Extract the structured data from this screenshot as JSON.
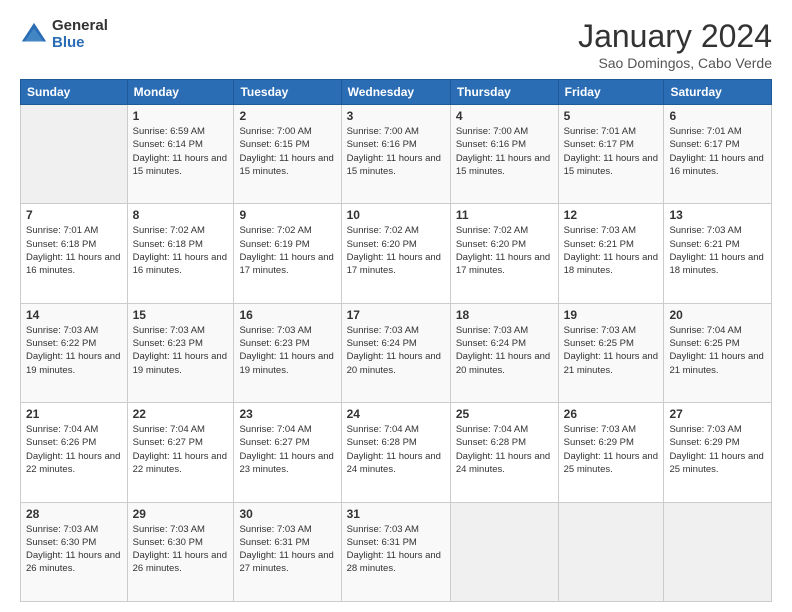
{
  "logo": {
    "general": "General",
    "blue": "Blue"
  },
  "title": "January 2024",
  "location": "Sao Domingos, Cabo Verde",
  "headers": [
    "Sunday",
    "Monday",
    "Tuesday",
    "Wednesday",
    "Thursday",
    "Friday",
    "Saturday"
  ],
  "weeks": [
    [
      {
        "day": "",
        "sunrise": "",
        "sunset": "",
        "daylight": ""
      },
      {
        "day": "1",
        "sunrise": "Sunrise: 6:59 AM",
        "sunset": "Sunset: 6:14 PM",
        "daylight": "Daylight: 11 hours and 15 minutes."
      },
      {
        "day": "2",
        "sunrise": "Sunrise: 7:00 AM",
        "sunset": "Sunset: 6:15 PM",
        "daylight": "Daylight: 11 hours and 15 minutes."
      },
      {
        "day": "3",
        "sunrise": "Sunrise: 7:00 AM",
        "sunset": "Sunset: 6:16 PM",
        "daylight": "Daylight: 11 hours and 15 minutes."
      },
      {
        "day": "4",
        "sunrise": "Sunrise: 7:00 AM",
        "sunset": "Sunset: 6:16 PM",
        "daylight": "Daylight: 11 hours and 15 minutes."
      },
      {
        "day": "5",
        "sunrise": "Sunrise: 7:01 AM",
        "sunset": "Sunset: 6:17 PM",
        "daylight": "Daylight: 11 hours and 15 minutes."
      },
      {
        "day": "6",
        "sunrise": "Sunrise: 7:01 AM",
        "sunset": "Sunset: 6:17 PM",
        "daylight": "Daylight: 11 hours and 16 minutes."
      }
    ],
    [
      {
        "day": "7",
        "sunrise": "Sunrise: 7:01 AM",
        "sunset": "Sunset: 6:18 PM",
        "daylight": "Daylight: 11 hours and 16 minutes."
      },
      {
        "day": "8",
        "sunrise": "Sunrise: 7:02 AM",
        "sunset": "Sunset: 6:18 PM",
        "daylight": "Daylight: 11 hours and 16 minutes."
      },
      {
        "day": "9",
        "sunrise": "Sunrise: 7:02 AM",
        "sunset": "Sunset: 6:19 PM",
        "daylight": "Daylight: 11 hours and 17 minutes."
      },
      {
        "day": "10",
        "sunrise": "Sunrise: 7:02 AM",
        "sunset": "Sunset: 6:20 PM",
        "daylight": "Daylight: 11 hours and 17 minutes."
      },
      {
        "day": "11",
        "sunrise": "Sunrise: 7:02 AM",
        "sunset": "Sunset: 6:20 PM",
        "daylight": "Daylight: 11 hours and 17 minutes."
      },
      {
        "day": "12",
        "sunrise": "Sunrise: 7:03 AM",
        "sunset": "Sunset: 6:21 PM",
        "daylight": "Daylight: 11 hours and 18 minutes."
      },
      {
        "day": "13",
        "sunrise": "Sunrise: 7:03 AM",
        "sunset": "Sunset: 6:21 PM",
        "daylight": "Daylight: 11 hours and 18 minutes."
      }
    ],
    [
      {
        "day": "14",
        "sunrise": "Sunrise: 7:03 AM",
        "sunset": "Sunset: 6:22 PM",
        "daylight": "Daylight: 11 hours and 19 minutes."
      },
      {
        "day": "15",
        "sunrise": "Sunrise: 7:03 AM",
        "sunset": "Sunset: 6:23 PM",
        "daylight": "Daylight: 11 hours and 19 minutes."
      },
      {
        "day": "16",
        "sunrise": "Sunrise: 7:03 AM",
        "sunset": "Sunset: 6:23 PM",
        "daylight": "Daylight: 11 hours and 19 minutes."
      },
      {
        "day": "17",
        "sunrise": "Sunrise: 7:03 AM",
        "sunset": "Sunset: 6:24 PM",
        "daylight": "Daylight: 11 hours and 20 minutes."
      },
      {
        "day": "18",
        "sunrise": "Sunrise: 7:03 AM",
        "sunset": "Sunset: 6:24 PM",
        "daylight": "Daylight: 11 hours and 20 minutes."
      },
      {
        "day": "19",
        "sunrise": "Sunrise: 7:03 AM",
        "sunset": "Sunset: 6:25 PM",
        "daylight": "Daylight: 11 hours and 21 minutes."
      },
      {
        "day": "20",
        "sunrise": "Sunrise: 7:04 AM",
        "sunset": "Sunset: 6:25 PM",
        "daylight": "Daylight: 11 hours and 21 minutes."
      }
    ],
    [
      {
        "day": "21",
        "sunrise": "Sunrise: 7:04 AM",
        "sunset": "Sunset: 6:26 PM",
        "daylight": "Daylight: 11 hours and 22 minutes."
      },
      {
        "day": "22",
        "sunrise": "Sunrise: 7:04 AM",
        "sunset": "Sunset: 6:27 PM",
        "daylight": "Daylight: 11 hours and 22 minutes."
      },
      {
        "day": "23",
        "sunrise": "Sunrise: 7:04 AM",
        "sunset": "Sunset: 6:27 PM",
        "daylight": "Daylight: 11 hours and 23 minutes."
      },
      {
        "day": "24",
        "sunrise": "Sunrise: 7:04 AM",
        "sunset": "Sunset: 6:28 PM",
        "daylight": "Daylight: 11 hours and 24 minutes."
      },
      {
        "day": "25",
        "sunrise": "Sunrise: 7:04 AM",
        "sunset": "Sunset: 6:28 PM",
        "daylight": "Daylight: 11 hours and 24 minutes."
      },
      {
        "day": "26",
        "sunrise": "Sunrise: 7:03 AM",
        "sunset": "Sunset: 6:29 PM",
        "daylight": "Daylight: 11 hours and 25 minutes."
      },
      {
        "day": "27",
        "sunrise": "Sunrise: 7:03 AM",
        "sunset": "Sunset: 6:29 PM",
        "daylight": "Daylight: 11 hours and 25 minutes."
      }
    ],
    [
      {
        "day": "28",
        "sunrise": "Sunrise: 7:03 AM",
        "sunset": "Sunset: 6:30 PM",
        "daylight": "Daylight: 11 hours and 26 minutes."
      },
      {
        "day": "29",
        "sunrise": "Sunrise: 7:03 AM",
        "sunset": "Sunset: 6:30 PM",
        "daylight": "Daylight: 11 hours and 26 minutes."
      },
      {
        "day": "30",
        "sunrise": "Sunrise: 7:03 AM",
        "sunset": "Sunset: 6:31 PM",
        "daylight": "Daylight: 11 hours and 27 minutes."
      },
      {
        "day": "31",
        "sunrise": "Sunrise: 7:03 AM",
        "sunset": "Sunset: 6:31 PM",
        "daylight": "Daylight: 11 hours and 28 minutes."
      },
      {
        "day": "",
        "sunrise": "",
        "sunset": "",
        "daylight": ""
      },
      {
        "day": "",
        "sunrise": "",
        "sunset": "",
        "daylight": ""
      },
      {
        "day": "",
        "sunrise": "",
        "sunset": "",
        "daylight": ""
      }
    ]
  ]
}
